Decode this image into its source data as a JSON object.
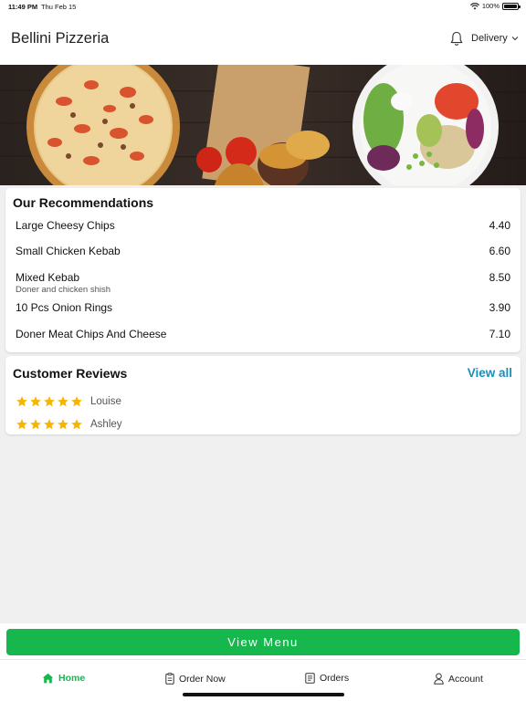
{
  "status_bar": {
    "time": "11:49 PM",
    "date": "Thu Feb 15",
    "battery": "100%"
  },
  "header": {
    "title": "Bellini Pizzeria",
    "delivery_label": "Delivery",
    "icons": [
      "bell-icon",
      "chevron-down-icon"
    ]
  },
  "banner": {
    "description_icons": [
      "pizza",
      "burgers",
      "salad-bowl"
    ]
  },
  "recommendations": {
    "title": "Our Recommendations",
    "items": [
      {
        "name": "Large Cheesy Chips",
        "desc": "",
        "price": "4.40"
      },
      {
        "name": "Small Chicken Kebab",
        "desc": "",
        "price": "6.60"
      },
      {
        "name": "Mixed Kebab",
        "desc": "Doner and chicken shish",
        "price": "8.50"
      },
      {
        "name": "10 Pcs Onion Rings",
        "desc": "",
        "price": "3.90"
      },
      {
        "name": "Doner Meat Chips And Cheese",
        "desc": "",
        "price": "7.10"
      }
    ]
  },
  "reviews": {
    "title": "Customer Reviews",
    "view_all": "View all",
    "items": [
      {
        "name": "Louise",
        "rating": 5
      },
      {
        "name": "Ashley",
        "rating": 5
      }
    ]
  },
  "view_menu_label": "View Menu",
  "tabs": [
    {
      "label": "Home",
      "icon": "home-icon",
      "active": true
    },
    {
      "label": "Order Now",
      "icon": "order-icon",
      "active": false
    },
    {
      "label": "Orders",
      "icon": "receipt-icon",
      "active": false
    },
    {
      "label": "Account",
      "icon": "user-icon",
      "active": false
    }
  ],
  "colors": {
    "accent_green": "#16b74c",
    "link_blue": "#1a8ebe",
    "star_gold": "#f7b500"
  }
}
